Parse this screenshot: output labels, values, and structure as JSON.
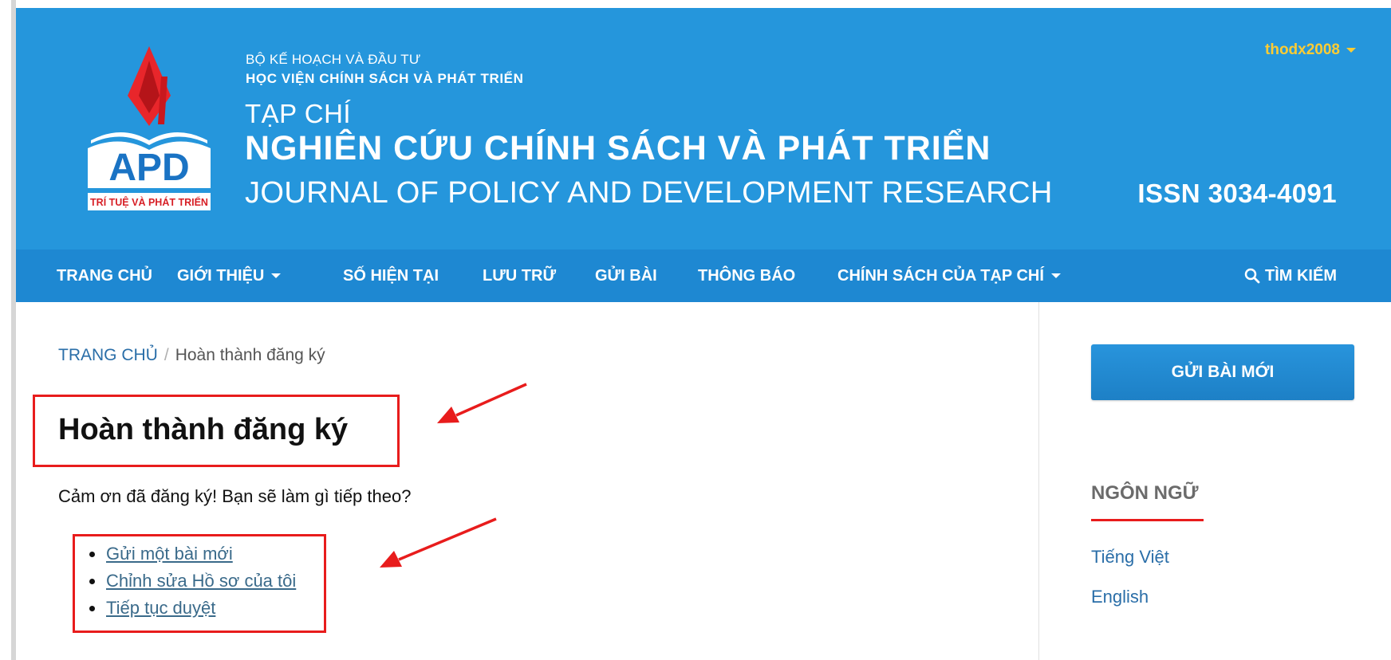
{
  "header": {
    "ministry": "BỘ KẾ HOẠCH VÀ ĐẦU TƯ",
    "academy": "HỌC VIỆN CHÍNH SÁCH VÀ PHÁT TRIỂN",
    "journal_label": "TẠP CHÍ",
    "journal_name": "NGHIÊN CỨU CHÍNH SÁCH VÀ PHÁT TRIỂN",
    "journal_name_en": "JOURNAL OF POLICY AND DEVELOPMENT RESEARCH",
    "issn": "ISSN 3034-4091",
    "user": "thodx2008",
    "logo": {
      "letters": "APD",
      "tagline": "TRÍ TUỆ VÀ PHÁT TRIỂN"
    }
  },
  "nav": {
    "items": [
      {
        "label": "TRANG CHỦ"
      },
      {
        "label": "GIỚI THIỆU"
      },
      {
        "label": "SỐ HIỆN TẠI"
      },
      {
        "label": "LƯU TRỮ"
      },
      {
        "label": "GỬI BÀI"
      },
      {
        "label": "THÔNG BÁO"
      },
      {
        "label": "CHÍNH SÁCH CỦA TẠP CHÍ"
      }
    ],
    "search": "TÌM KIẾM"
  },
  "breadcrumb": {
    "home": "TRANG CHỦ",
    "separator": "/",
    "current": "Hoàn thành đăng ký"
  },
  "main": {
    "title": "Hoàn thành đăng ký",
    "intro": "Cảm ơn đã đăng ký! Bạn sẽ làm gì tiếp theo?",
    "links": [
      {
        "label": "Gửi một bài mới"
      },
      {
        "label": "Chỉnh sửa Hồ sơ của tôi"
      },
      {
        "label": "Tiếp tục duyệt"
      }
    ]
  },
  "sidebar": {
    "submit_button": "GỬI BÀI MỚI",
    "language_heading": "NGÔN NGỮ",
    "languages": [
      {
        "label": "Tiếng Việt"
      },
      {
        "label": "English"
      }
    ]
  },
  "colors": {
    "header_bg": "#2596dc",
    "nav_bg": "#1e88d2",
    "user_accent": "#ffcc33",
    "annotation_red": "#e81c1c",
    "link": "#2a6ea8"
  }
}
